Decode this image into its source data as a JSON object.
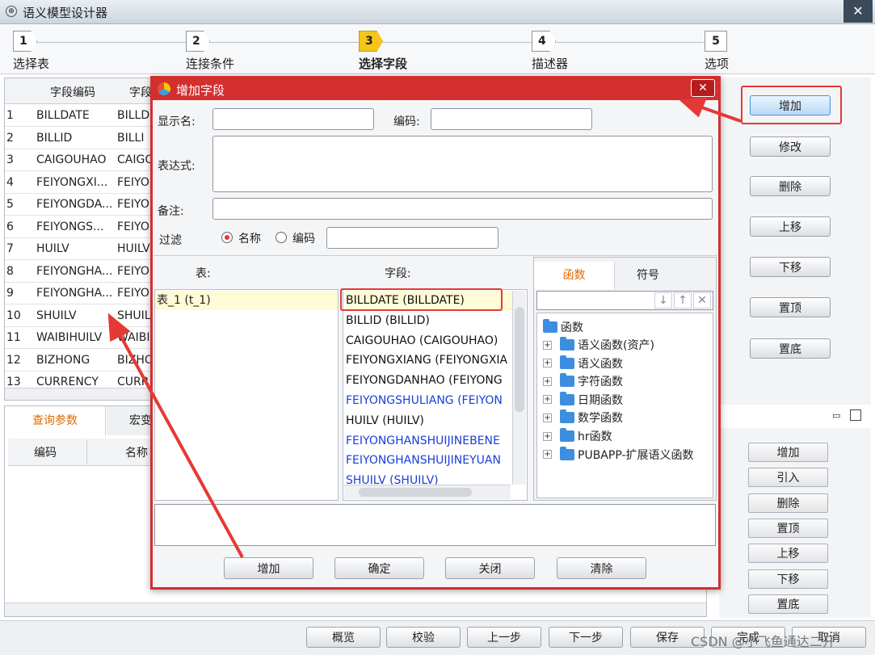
{
  "window": {
    "title": "语义模型设计器",
    "close": "✕"
  },
  "steps": [
    {
      "num": "1",
      "label": "选择表"
    },
    {
      "num": "2",
      "label": "连接条件"
    },
    {
      "num": "3",
      "label": "选择字段"
    },
    {
      "num": "4",
      "label": "描述器"
    },
    {
      "num": "5",
      "label": "选项"
    }
  ],
  "field_table": {
    "headers": [
      "字段编码",
      "字段"
    ],
    "rows": [
      {
        "n": "1",
        "code": "BILLDATE",
        "name": "BILLD"
      },
      {
        "n": "2",
        "code": "BILLID",
        "name": "BILLI"
      },
      {
        "n": "3",
        "code": "CAIGOUHAO",
        "name": "CAIGO"
      },
      {
        "n": "4",
        "code": "FEIYONGXI...",
        "name": "FEIYO"
      },
      {
        "n": "5",
        "code": "FEIYONGDA...",
        "name": "FEIYO"
      },
      {
        "n": "6",
        "code": "FEIYONGS...",
        "name": "FEIYO"
      },
      {
        "n": "7",
        "code": "HUILV",
        "name": "HUILV"
      },
      {
        "n": "8",
        "code": "FEIYONGHA...",
        "name": "FEIYO"
      },
      {
        "n": "9",
        "code": "FEIYONGHA...",
        "name": "FEIYO"
      },
      {
        "n": "10",
        "code": "SHUILV",
        "name": "SHUIL"
      },
      {
        "n": "11",
        "code": "WAIBIHUILV",
        "name": "WAIBI"
      },
      {
        "n": "12",
        "code": "BIZHONG",
        "name": "BIZHO"
      },
      {
        "n": "13",
        "code": "CURRENCY",
        "name": "CURR"
      }
    ]
  },
  "right_buttons": [
    "增加",
    "修改",
    "删除",
    "上移",
    "下移",
    "置顶",
    "置底"
  ],
  "bottom_tabs": [
    "查询参数",
    "宏变"
  ],
  "param_headers": [
    "编码",
    "名称"
  ],
  "param_buttons": [
    "增加",
    "引入",
    "删除",
    "置顶",
    "上移",
    "下移",
    "置底"
  ],
  "footer_buttons": [
    "概览",
    "校验",
    "上一步",
    "下一步",
    "保存",
    "完成",
    "取消"
  ],
  "watermark": "CSDN @小飞鱼通达二开",
  "dialog": {
    "title": "增加字段",
    "close": "✕",
    "display_name_label": "显示名:",
    "code_label": "编码:",
    "expression_label": "表达式:",
    "note_label": "备注:",
    "filter_label": "过滤",
    "radio_name": "名称",
    "radio_code": "编码",
    "table_col_label": "表:",
    "field_col_label": "字段:",
    "tables": [
      "表_1 (t_1)"
    ],
    "fields": [
      {
        "label": "BILLDATE (BILLDATE)",
        "color": "#111111"
      },
      {
        "label": "BILLID (BILLID)",
        "color": "#111111"
      },
      {
        "label": "CAIGOUHAO (CAIGOUHAO)",
        "color": "#111111"
      },
      {
        "label": "FEIYONGXIANG (FEIYONGXIA",
        "color": "#111111"
      },
      {
        "label": "FEIYONGDANHAO (FEIYONG",
        "color": "#111111"
      },
      {
        "label": "FEIYONGSHULIANG (FEIYON",
        "color": "#1a3fd6"
      },
      {
        "label": "HUILV (HUILV)",
        "color": "#111111"
      },
      {
        "label": "FEIYONGHANSHUIJINEBENE",
        "color": "#1a3fd6"
      },
      {
        "label": "FEIYONGHANSHUIJINEYUAN",
        "color": "#1a3fd6"
      },
      {
        "label": "SHUILV (SHUILV)",
        "color": "#1a3fd6"
      }
    ],
    "tabs": [
      "函数",
      "符号"
    ],
    "tree_root": "函数",
    "tree_items": [
      "语义函数(资产)",
      "语义函数",
      "字符函数",
      "日期函数",
      "数学函数",
      "hr函数",
      "PUBAPP-扩展语义函数"
    ],
    "buttons": [
      "增加",
      "确定",
      "关闭",
      "清除"
    ]
  },
  "colors": {
    "accent_red": "#e53935",
    "dialog_title": "#d32f2f",
    "tab_orange": "#e06a00",
    "step_active": "#f5c518"
  }
}
